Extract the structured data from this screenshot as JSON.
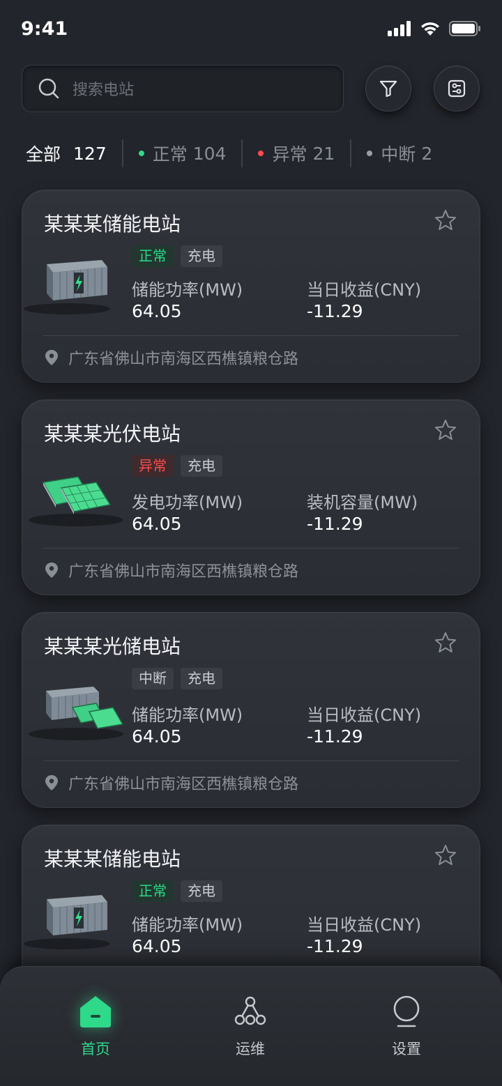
{
  "status_bar": {
    "time": "9:41"
  },
  "search": {
    "placeholder": "搜索电站"
  },
  "filters": {
    "all": {
      "label": "全部",
      "count": "127"
    },
    "normal": {
      "label": "正常",
      "count": "104",
      "color": "#2fd98a"
    },
    "abnormal": {
      "label": "异常",
      "count": "21",
      "color": "#ff4d4f"
    },
    "interrupt": {
      "label": "中断",
      "count": "2",
      "color": "#9a9ea5"
    }
  },
  "stations": [
    {
      "name": "某某某储能电站",
      "status": "正常",
      "mode": "充电",
      "metric1_label": "储能功率(MW)",
      "metric1_value": "64.05",
      "metric2_label": "当日收益(CNY)",
      "metric2_value": "-11.29",
      "address": "广东省佛山市南海区西樵镇粮仓路",
      "image": "battery-container"
    },
    {
      "name": "某某某光伏电站",
      "status": "异常",
      "mode": "充电",
      "metric1_label": "发电功率(MW)",
      "metric1_value": "64.05",
      "metric2_label": "装机容量(MW)",
      "metric2_value": "-11.29",
      "address": "广东省佛山市南海区西樵镇粮仓路",
      "image": "solar-panels"
    },
    {
      "name": "某某某光储电站",
      "status": "中断",
      "mode": "充电",
      "metric1_label": "储能功率(MW)",
      "metric1_value": "64.05",
      "metric2_label": "当日收益(CNY)",
      "metric2_value": "-11.29",
      "address": "广东省佛山市南海区西樵镇粮仓路",
      "image": "solar-storage"
    },
    {
      "name": "某某某储能电站",
      "status": "正常",
      "mode": "充电",
      "metric1_label": "储能功率(MW)",
      "metric1_value": "64.05",
      "metric2_label": "当日收益(CNY)",
      "metric2_value": "-11.29",
      "image": "battery-container"
    }
  ],
  "nav": {
    "home": "首页",
    "ops": "运维",
    "settings": "设置"
  },
  "colors": {
    "accent": "#2fd98a",
    "danger": "#ff4d4f",
    "background": "#22252b"
  }
}
